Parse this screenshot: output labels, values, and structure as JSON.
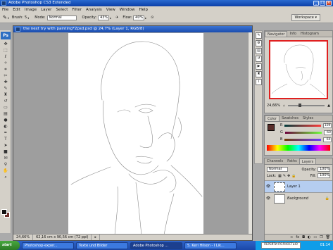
{
  "window": {
    "title": "Adobe Photoshop CS3 Extended"
  },
  "menu": {
    "items": [
      "File",
      "Edit",
      "Image",
      "Layer",
      "Select",
      "Filter",
      "Analysis",
      "View",
      "Window",
      "Help"
    ]
  },
  "options": {
    "brush_label": "Brush:",
    "brush_size": "5",
    "mode_label": "Mode:",
    "mode_value": "Normal",
    "opacity_label": "Opacity:",
    "opacity_value": "43%",
    "flow_label": "Flow:",
    "flow_value": "40%",
    "workspace_label": "Workspace"
  },
  "toolbox": {
    "logo": "Ps",
    "tools": [
      "move-icon",
      "marquee-icon",
      "lasso-icon",
      "magic-wand-icon",
      "crop-icon",
      "slice-icon",
      "healing-icon",
      "brush-icon",
      "stamp-icon",
      "history-brush-icon",
      "eraser-icon",
      "gradient-icon",
      "blur-icon",
      "dodge-icon",
      "pen-icon",
      "type-icon",
      "path-select-icon",
      "shape-icon",
      "notes-icon",
      "eyedropper-icon",
      "hand-icon",
      "zoom-icon"
    ],
    "foreground_color": "#111111",
    "background_color": "#6b2f2a"
  },
  "document": {
    "title": "the next try with painting*2psd.psd @ 24,7% (Layer 1, RGB/8)",
    "zoom": "24,66%",
    "doc_size": "62,16 cm x 90,56 cm (72 ppi)"
  },
  "navigator": {
    "tabs": [
      "Navigator",
      "Info",
      "Histogram"
    ],
    "zoom": "24,66%"
  },
  "color_panel": {
    "tabs": [
      "Color",
      "Swatches",
      "Styles"
    ],
    "r_label": "R",
    "g_label": "G",
    "b_label": "B",
    "r_value": "109",
    "g_value": "60",
    "b_value": "60",
    "chip_color": "#5a2e2a"
  },
  "layers_panel": {
    "tabs": [
      "Channels",
      "Paths",
      "Layers"
    ],
    "blend_mode": "Normal",
    "opacity_label": "Opacity:",
    "opacity_value": "100%",
    "lock_label": "Lock:",
    "fill_label": "Fill:",
    "fill_value": "100%",
    "layers": [
      {
        "name": "Layer 1",
        "selected": true
      },
      {
        "name": "Background",
        "selected": false
      }
    ]
  },
  "taskbar": {
    "start_label": "start",
    "tasks": [
      "Photoshop-exper...",
      "Texte und Bilder",
      "Adobe Photoshop ...",
      "5. Keri Hilson - I Lik..."
    ],
    "badge": "ПЕРЕЙТИ ПОЛНОСТЬЮ",
    "clock": "01:14"
  }
}
